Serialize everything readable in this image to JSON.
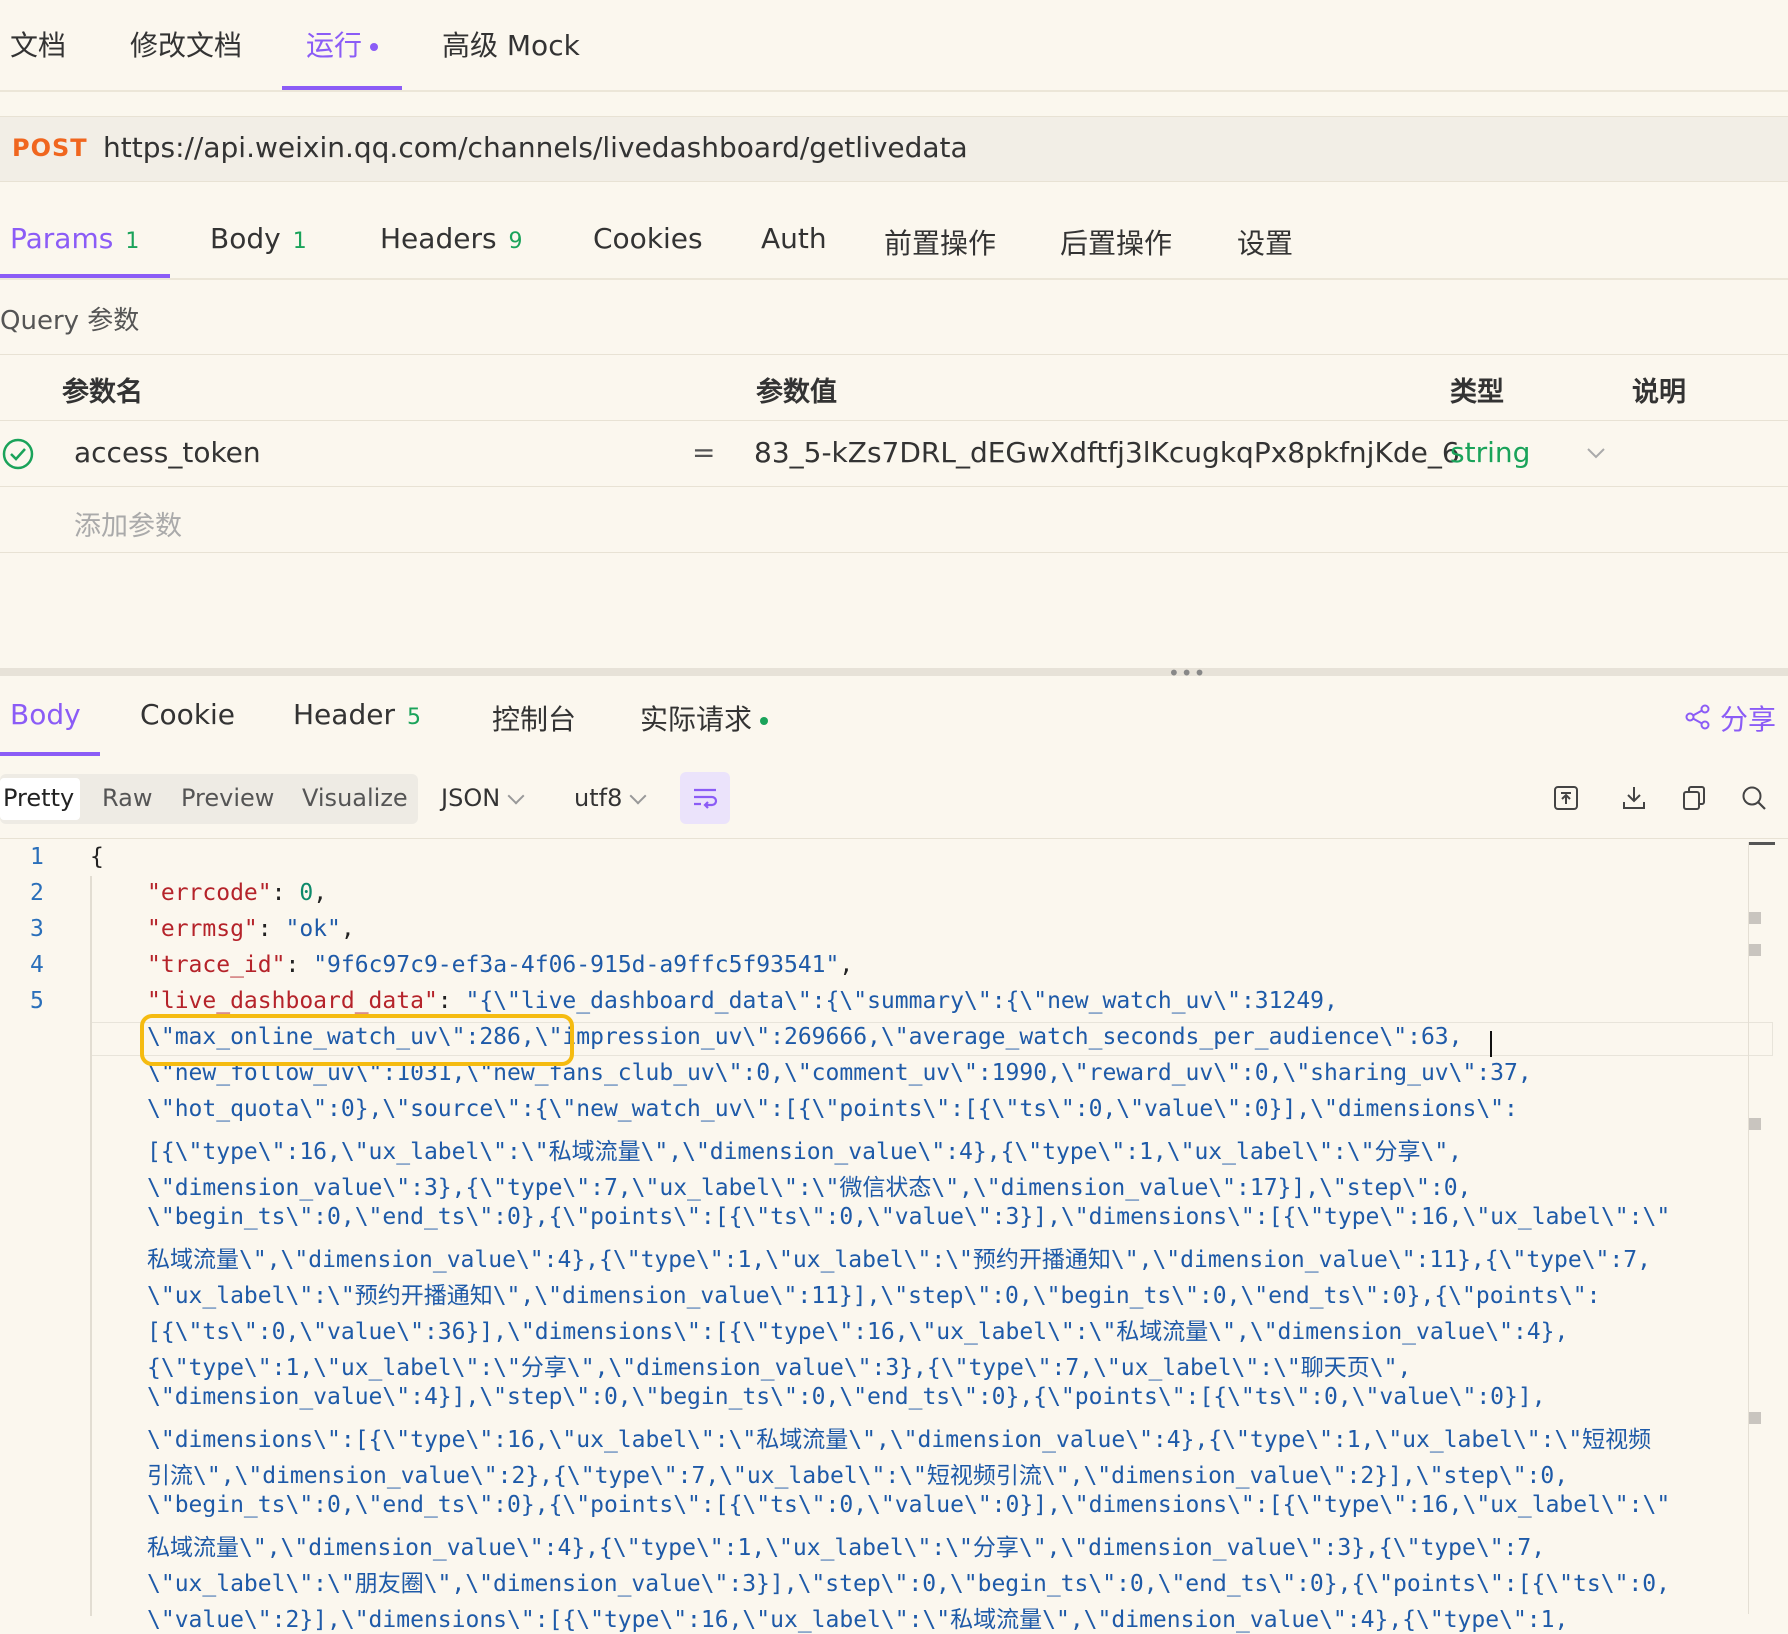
{
  "top_tabs": [
    {
      "label": "文档"
    },
    {
      "label": "修改文档"
    },
    {
      "label": "运行"
    },
    {
      "label": "高级 Mock"
    }
  ],
  "request": {
    "method": "POST",
    "url": "https://api.weixin.qq.com/channels/livedashboard/getlivedata"
  },
  "request_tabs": [
    {
      "label": "Params",
      "count": "1"
    },
    {
      "label": "Body",
      "count": "1"
    },
    {
      "label": "Headers",
      "count": "9"
    },
    {
      "label": "Cookies"
    },
    {
      "label": "Auth"
    },
    {
      "label": "前置操作"
    },
    {
      "label": "后置操作"
    },
    {
      "label": "设置"
    }
  ],
  "query_label": "Query 参数",
  "params_table": {
    "headers": [
      "参数名",
      "参数值",
      "类型",
      "说明"
    ],
    "rows": [
      {
        "name": "access_token",
        "equals": "=",
        "value": "83_5-kZs7DRL_dEGwXdftfj3lKcugkqPx8pkfnjKde_6",
        "type": "string"
      }
    ],
    "add_placeholder": "添加参数"
  },
  "response_tabs": [
    {
      "label": "Body"
    },
    {
      "label": "Cookie"
    },
    {
      "label": "Header",
      "count": "5"
    },
    {
      "label": "控制台"
    },
    {
      "label": "实际请求"
    }
  ],
  "share_label": "分享",
  "view_modes": [
    "Pretty",
    "Raw",
    "Preview",
    "Visualize"
  ],
  "format_select": "JSON",
  "encoding_select": "utf8",
  "line_numbers": [
    "1",
    "2",
    "3",
    "4",
    "5"
  ],
  "code": {
    "l1": "{",
    "errcode_key": "\"errcode\"",
    "errcode_val": "0",
    "errmsg_key": "\"errmsg\"",
    "errmsg_val": "\"ok\"",
    "trace_key": "\"trace_id\"",
    "trace_val": "\"9f6c97c9-ef3a-4f06-915d-a9ffc5f93541\"",
    "ldd_key": "\"live_dashboard_data\"",
    "ldd_start": "\"{\\\"live_dashboard_data\\\":{\\\"summary\\\":{\\\"new_watch_uv\\\":31249,",
    "w1": "\\\"max_online_watch_uv\\\":286,\\\"impression_uv\\\":269666,\\\"average_watch_seconds_per_audience\\\":63,",
    "w2": "\\\"new_follow_uv\\\":1031,\\\"new_fans_club_uv\\\":0,\\\"comment_uv\\\":1990,\\\"reward_uv\\\":0,\\\"sharing_uv\\\":37,",
    "w3": "\\\"hot_quota\\\":0},\\\"source\\\":{\\\"new_watch_uv\\\":[{\\\"points\\\":[{\\\"ts\\\":0,\\\"value\\\":0}],\\\"dimensions\\\":",
    "w4": "[{\\\"type\\\":16,\\\"ux_label\\\":\\\"私域流量\\\",\\\"dimension_value\\\":4},{\\\"type\\\":1,\\\"ux_label\\\":\\\"分享\\\",",
    "w5": "\\\"dimension_value\\\":3},{\\\"type\\\":7,\\\"ux_label\\\":\\\"微信状态\\\",\\\"dimension_value\\\":17}],\\\"step\\\":0,",
    "w6": "\\\"begin_ts\\\":0,\\\"end_ts\\\":0},{\\\"points\\\":[{\\\"ts\\\":0,\\\"value\\\":3}],\\\"dimensions\\\":[{\\\"type\\\":16,\\\"ux_label\\\":\\\"",
    "w7": "私域流量\\\",\\\"dimension_value\\\":4},{\\\"type\\\":1,\\\"ux_label\\\":\\\"预约开播通知\\\",\\\"dimension_value\\\":11},{\\\"type\\\":7,",
    "w8": "\\\"ux_label\\\":\\\"预约开播通知\\\",\\\"dimension_value\\\":11}],\\\"step\\\":0,\\\"begin_ts\\\":0,\\\"end_ts\\\":0},{\\\"points\\\":",
    "w9": "[{\\\"ts\\\":0,\\\"value\\\":36}],\\\"dimensions\\\":[{\\\"type\\\":16,\\\"ux_label\\\":\\\"私域流量\\\",\\\"dimension_value\\\":4},",
    "w10": "{\\\"type\\\":1,\\\"ux_label\\\":\\\"分享\\\",\\\"dimension_value\\\":3},{\\\"type\\\":7,\\\"ux_label\\\":\\\"聊天页\\\",",
    "w11": "\\\"dimension_value\\\":4}],\\\"step\\\":0,\\\"begin_ts\\\":0,\\\"end_ts\\\":0},{\\\"points\\\":[{\\\"ts\\\":0,\\\"value\\\":0}],",
    "w12": "\\\"dimensions\\\":[{\\\"type\\\":16,\\\"ux_label\\\":\\\"私域流量\\\",\\\"dimension_value\\\":4},{\\\"type\\\":1,\\\"ux_label\\\":\\\"短视频",
    "w13": "引流\\\",\\\"dimension_value\\\":2},{\\\"type\\\":7,\\\"ux_label\\\":\\\"短视频引流\\\",\\\"dimension_value\\\":2}],\\\"step\\\":0,",
    "w14": "\\\"begin_ts\\\":0,\\\"end_ts\\\":0},{\\\"points\\\":[{\\\"ts\\\":0,\\\"value\\\":0}],\\\"dimensions\\\":[{\\\"type\\\":16,\\\"ux_label\\\":\\\"",
    "w15": "私域流量\\\",\\\"dimension_value\\\":4},{\\\"type\\\":1,\\\"ux_label\\\":\\\"分享\\\",\\\"dimension_value\\\":3},{\\\"type\\\":7,",
    "w16": "\\\"ux_label\\\":\\\"朋友圈\\\",\\\"dimension_value\\\":3}],\\\"step\\\":0,\\\"begin_ts\\\":0,\\\"end_ts\\\":0},{\\\"points\\\":[{\\\"ts\\\":0,",
    "w17": "\\\"value\\\":2}],\\\"dimensions\\\":[{\\\"type\\\":16,\\\"ux_label\\\":\\\"私域流量\\\",\\\"dimension_value\\\":4},{\\\"type\\\":1,"
  },
  "colors": {
    "accent": "#8b5cf6",
    "post_method": "#f0661f",
    "count_green": "#1aa35a",
    "highlight_box": "#f5bb10",
    "background": "#fbf7ee"
  }
}
